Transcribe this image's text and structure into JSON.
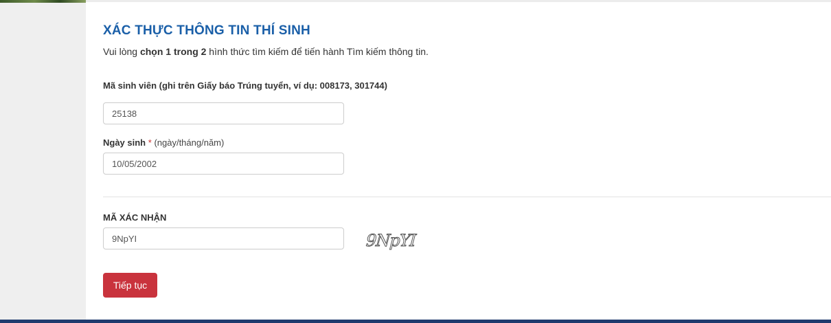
{
  "form": {
    "title": "XÁC THỰC THÔNG TIN THÍ SINH",
    "intro": {
      "prefix": "Vui lòng ",
      "bold1": "chọn 1 trong 2",
      "suffix": " hình thức tìm kiếm để tiến hành Tìm kiếm thông tin."
    },
    "student_id": {
      "label": "Mã sinh viên (ghi trên Giấy báo Trúng tuyển, ví dụ: 008173, 301744)",
      "value": "25138"
    },
    "birth_date": {
      "label": "Ngày sinh",
      "required_mark": "*",
      "hint": "(ngày/tháng/năm)",
      "value": "10/05/2002"
    },
    "captcha": {
      "label": "MÃ XÁC NHẬN",
      "value": "9NpYI",
      "image_text": "9NpYI"
    },
    "submit_label": "Tiếp tục"
  },
  "colors": {
    "title": "#1a5fa8",
    "button": "#c9333d",
    "required": "#c9302c",
    "bottom_bar": "#1f3b6e"
  }
}
